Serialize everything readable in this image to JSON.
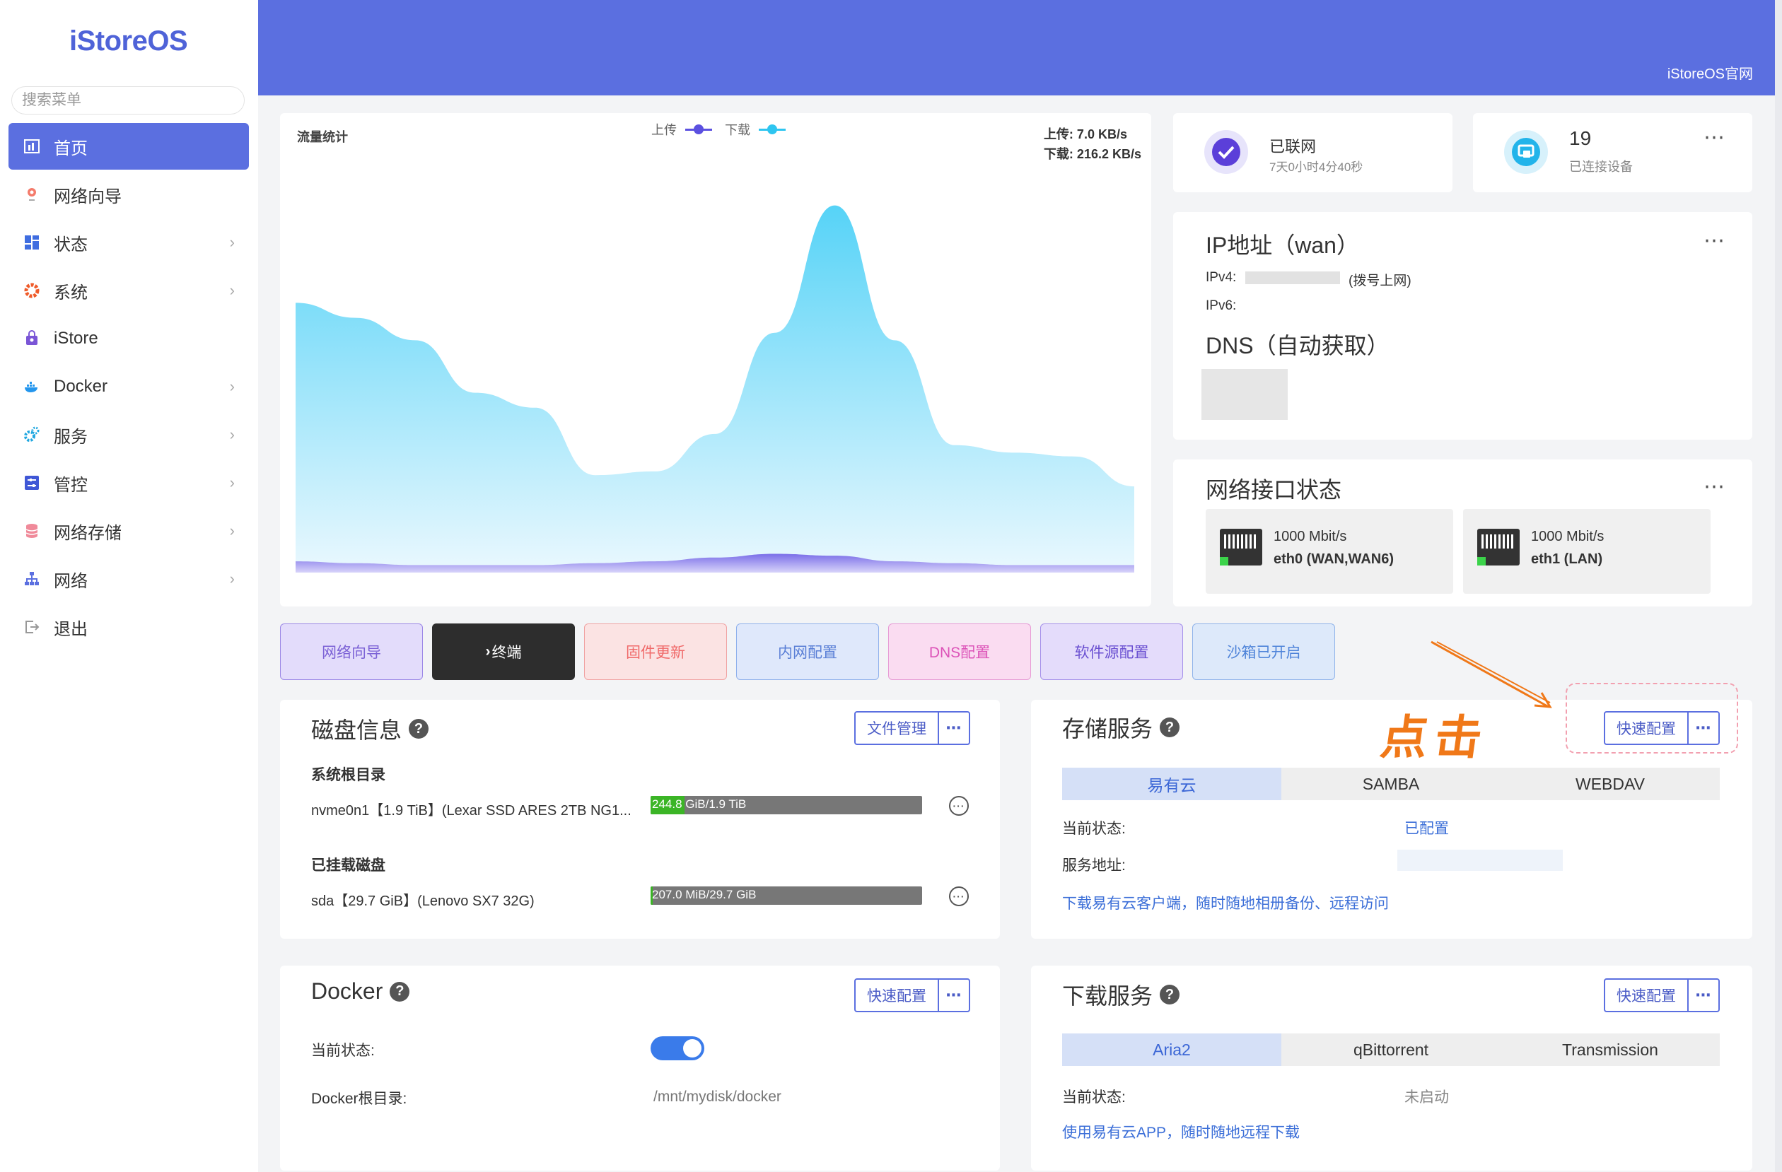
{
  "sidebar": {
    "logo": "iStoreOS",
    "search_placeholder": "搜索菜单",
    "items": [
      {
        "label": "首页",
        "icon": "chart-icon",
        "active": true
      },
      {
        "label": "网络向导",
        "icon": "map-pin-icon"
      },
      {
        "label": "状态",
        "icon": "dashboard-icon",
        "chevron": true
      },
      {
        "label": "系统",
        "icon": "gear-icon",
        "chevron": true
      },
      {
        "label": "iStore",
        "icon": "bag-icon"
      },
      {
        "label": "Docker",
        "icon": "docker-icon",
        "chevron": true
      },
      {
        "label": "服务",
        "icon": "cogs-icon",
        "chevron": true
      },
      {
        "label": "管控",
        "icon": "sliders-icon",
        "chevron": true
      },
      {
        "label": "网络存储",
        "icon": "database-icon",
        "chevron": true
      },
      {
        "label": "网络",
        "icon": "network-icon",
        "chevron": true
      },
      {
        "label": "退出",
        "icon": "logout-icon"
      }
    ]
  },
  "header": {
    "site_link": "iStoreOS官网"
  },
  "traffic": {
    "title": "流量统计",
    "legend_upload": "上传",
    "legend_download": "下载",
    "upload_speed": "上传: 7.0 KB/s",
    "download_speed": "下载: 216.2 KB/s",
    "colors": {
      "upload": "#5b50e0",
      "download": "#2ec5f0"
    },
    "download_series": [
      0.72,
      0.68,
      0.62,
      0.48,
      0.44,
      0.26,
      0.27,
      0.37,
      0.64,
      0.98,
      0.62,
      0.34,
      0.32,
      0.31,
      0.23
    ],
    "upload_series": [
      0.03,
      0.025,
      0.02,
      0.02,
      0.02,
      0.025,
      0.03,
      0.04,
      0.05,
      0.045,
      0.03,
      0.025,
      0.02,
      0.02,
      0.02
    ]
  },
  "network_status": {
    "title": "已联网",
    "uptime": "7天0小时4分40秒"
  },
  "devices": {
    "count": "19",
    "label": "已连接设备"
  },
  "ip": {
    "title": "IP地址（wan）",
    "ipv4_label": "IPv4:",
    "ipv4_note": "(拨号上网)",
    "ipv6_label": "IPv6:",
    "dns_title": "DNS（自动获取）"
  },
  "interfaces": {
    "title": "网络接口状态",
    "items": [
      {
        "speed": "1000 Mbit/s",
        "name": "eth0 (WAN,WAN6)"
      },
      {
        "speed": "1000 Mbit/s",
        "name": "eth1 (LAN)"
      }
    ]
  },
  "quick_buttons": [
    {
      "label": "网络向导",
      "bg": "#e3dcfb",
      "border": "#9b87e6",
      "color": "#7c62d6"
    },
    {
      "label": "终端",
      "prefix": "›",
      "bg": "#2d2d2d",
      "border": "#2d2d2d",
      "color": "#ffffff"
    },
    {
      "label": "固件更新",
      "bg": "#fbe3e3",
      "border": "#f0a2a2",
      "color": "#f06a6a"
    },
    {
      "label": "内网配置",
      "bg": "#dfe8fb",
      "border": "#8fb0ec",
      "color": "#5a7fd6"
    },
    {
      "label": "DNS配置",
      "bg": "#fadcf1",
      "border": "#e79ad5",
      "color": "#dc52b8"
    },
    {
      "label": "软件源配置",
      "bg": "#e4dcfb",
      "border": "#a590ea",
      "color": "#6a4fd1"
    },
    {
      "label": "沙箱已开启",
      "bg": "#dde9fa",
      "border": "#8fb3ea",
      "color": "#4f84d9"
    }
  ],
  "disk": {
    "title": "磁盘信息",
    "file_manager": "文件管理",
    "root_title": "系统根目录",
    "root_disk": "nvme0n1【1.9 TiB】(Lexar SSD ARES 2TB NG1...",
    "root_usage": "244.8 GiB/1.9 TiB",
    "root_fraction": 0.126,
    "mounted_title": "已挂载磁盘",
    "mounted_disk": "sda【29.7 GiB】(Lenovo SX7 32G)",
    "mounted_usage": "207.0 MiB/29.7 GiB",
    "mounted_fraction": 0.007
  },
  "storage": {
    "title": "存储服务",
    "annotation": "点击",
    "quick_config": "快速配置",
    "tabs": [
      "易有云",
      "SAMBA",
      "WEBDAV"
    ],
    "status_label": "当前状态:",
    "status_value": "已配置",
    "address_label": "服务地址:",
    "link": "下载易有云客户端，随时随地相册备份、远程访问"
  },
  "docker": {
    "title": "Docker",
    "quick_config": "快速配置",
    "status_label": "当前状态:",
    "root_label": "Docker根目录:",
    "root_value": "/mnt/mydisk/docker"
  },
  "download": {
    "title": "下载服务",
    "quick_config": "快速配置",
    "tabs": [
      "Aria2",
      "qBittorrent",
      "Transmission"
    ],
    "status_label": "当前状态:",
    "status_value": "未启动",
    "link": "使用易有云APP，随时随地远程下载"
  }
}
